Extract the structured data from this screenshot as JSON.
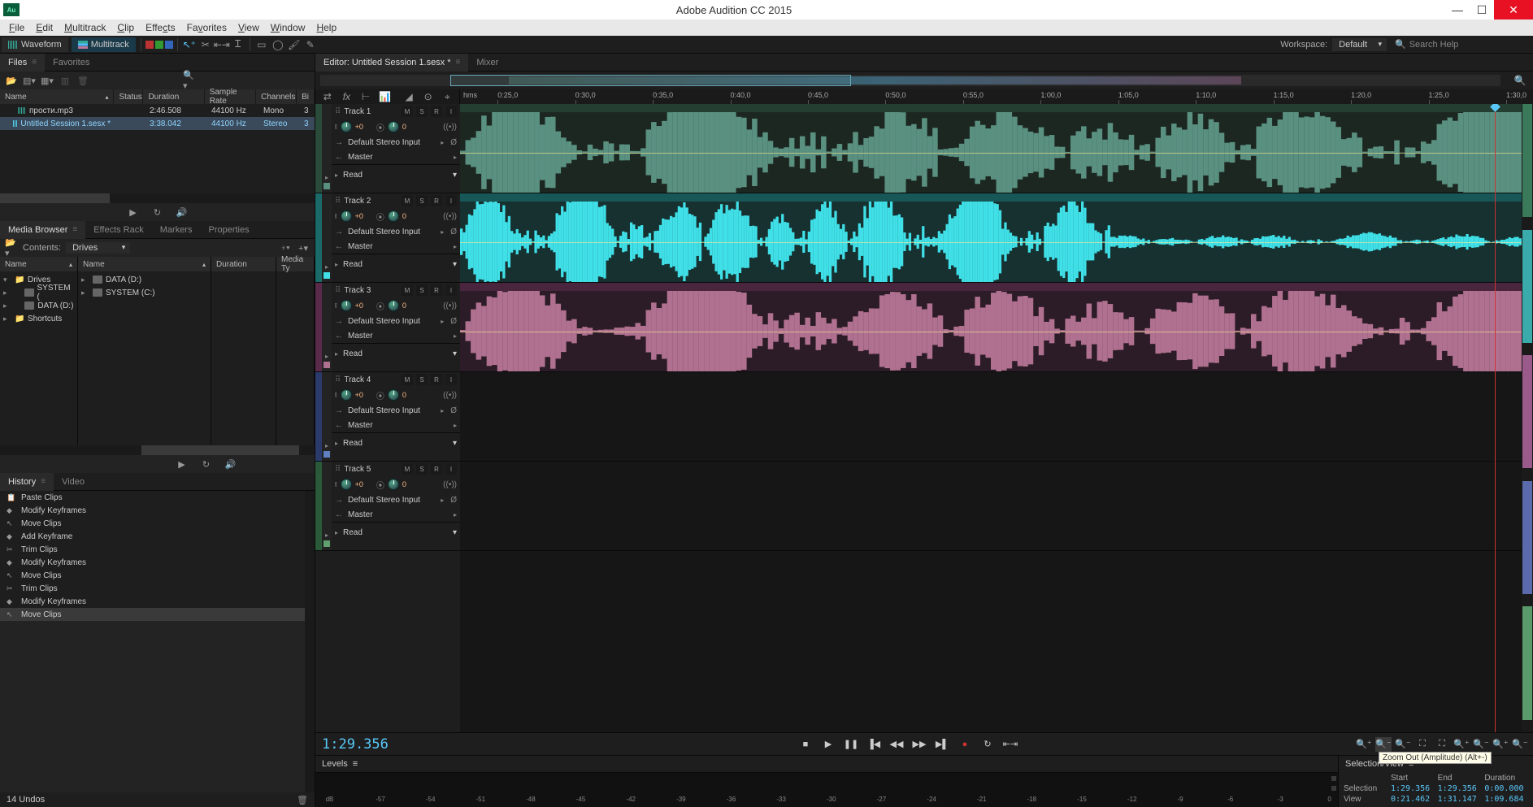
{
  "app": {
    "title": "Adobe Audition CC 2015",
    "icon_label": "Au"
  },
  "menu": [
    "File",
    "Edit",
    "Multitrack",
    "Clip",
    "Effects",
    "Favorites",
    "View",
    "Window",
    "Help"
  ],
  "modes": {
    "waveform": "Waveform",
    "multitrack": "Multitrack"
  },
  "workspace": {
    "label": "Workspace:",
    "value": "Default"
  },
  "search": {
    "placeholder": "Search Help"
  },
  "files": {
    "tab": "Files",
    "favorites_tab": "Favorites",
    "headers": {
      "name": "Name",
      "status": "Status",
      "duration": "Duration",
      "sample_rate": "Sample Rate",
      "channels": "Channels",
      "bit": "Bi"
    },
    "rows": [
      {
        "name": "прости.mp3",
        "status": "",
        "duration": "2:46.508",
        "sample_rate": "44100 Hz",
        "channels": "Mono",
        "bit": "3"
      },
      {
        "name": "Untitled Session 1.sesx *",
        "status": "",
        "duration": "3:38.042",
        "sample_rate": "44100 Hz",
        "channels": "Stereo",
        "bit": "3"
      }
    ]
  },
  "media": {
    "tab": "Media Browser",
    "other_tabs": [
      "Effects Rack",
      "Markers",
      "Properties"
    ],
    "contents_label": "Contents:",
    "contents_value": "Drives",
    "col1": {
      "header": "Name",
      "items": [
        "Drives",
        "SYSTEM (",
        "DATA (D:)",
        "Shortcuts"
      ]
    },
    "col2": {
      "header": "Name",
      "items": [
        "DATA (D:)",
        "SYSTEM (C:)"
      ]
    },
    "col3": {
      "header": "Duration"
    },
    "col4": {
      "header": "Media Ty"
    }
  },
  "history": {
    "tab": "History",
    "other_tab": "Video",
    "items": [
      "Paste Clips",
      "Modify Keyframes",
      "Move Clips",
      "Add Keyframe",
      "Trim Clips",
      "Modify Keyframes",
      "Move Clips",
      "Trim Clips",
      "Modify Keyframes",
      "Move Clips"
    ],
    "selected_index": 9,
    "status": "14 Undos"
  },
  "editor": {
    "tab": "Editor: Untitled Session 1.sesx *",
    "mixer_tab": "Mixer",
    "timecode": "1:29.356",
    "hms_label": "hms",
    "ruler_marks": [
      "0:25,0",
      "0:30,0",
      "0:35,0",
      "0:40,0",
      "0:45,0",
      "0:50,0",
      "0:55,0",
      "1:00,0",
      "1:05,0",
      "1:10,0",
      "1:15,0",
      "1:20,0",
      "1:25,0",
      "1:30,0"
    ],
    "tracks": [
      {
        "name": "Track 1",
        "vol": "+0",
        "pan": "0",
        "input": "Default Stereo Input",
        "output": "Master",
        "automation": "Read",
        "color": "#2a4a3a",
        "wave_color": "#5a9080",
        "has_clip": true
      },
      {
        "name": "Track 2",
        "vol": "+0",
        "pan": "0",
        "input": "Default Stereo Input",
        "output": "Master",
        "automation": "Read",
        "color": "#1a6a6a",
        "wave_color": "#40e0e8",
        "has_clip": true
      },
      {
        "name": "Track 3",
        "vol": "+0",
        "pan": "0",
        "input": "Default Stereo Input",
        "output": "Master",
        "automation": "Read",
        "color": "#5a2a4a",
        "wave_color": "#b07090",
        "has_clip": true
      },
      {
        "name": "Track 4",
        "vol": "+0",
        "pan": "0",
        "input": "Default Stereo Input",
        "output": "Master",
        "automation": "Read",
        "color": "#2a3a6a",
        "wave_color": "#6080c0",
        "has_clip": false
      },
      {
        "name": "Track 5",
        "vol": "+0",
        "pan": "0",
        "input": "Default Stereo Input",
        "output": "Master",
        "automation": "Read",
        "color": "#2a5a3a",
        "wave_color": "#60a070",
        "has_clip": false
      }
    ],
    "msr": [
      "M",
      "S",
      "R",
      "I"
    ]
  },
  "tooltip": "Zoom Out (Amplitude) (Alt+-)",
  "levels": {
    "label": "Levels",
    "scale": [
      "dB",
      "-57",
      "-54",
      "-51",
      "-48",
      "-45",
      "-42",
      "-39",
      "-36",
      "-33",
      "-30",
      "-27",
      "-24",
      "-21",
      "-18",
      "-15",
      "-12",
      "-9",
      "-6",
      "-3",
      "0"
    ]
  },
  "selview": {
    "label": "Selection/View",
    "headers": [
      "Start",
      "End",
      "Duration"
    ],
    "selection": {
      "label": "Selection",
      "start": "1:29.356",
      "end": "1:29.356",
      "duration": "0:00.000"
    },
    "view": {
      "label": "View",
      "start": "0:21.462",
      "end": "1:31.147",
      "duration": "1:09.684"
    }
  }
}
